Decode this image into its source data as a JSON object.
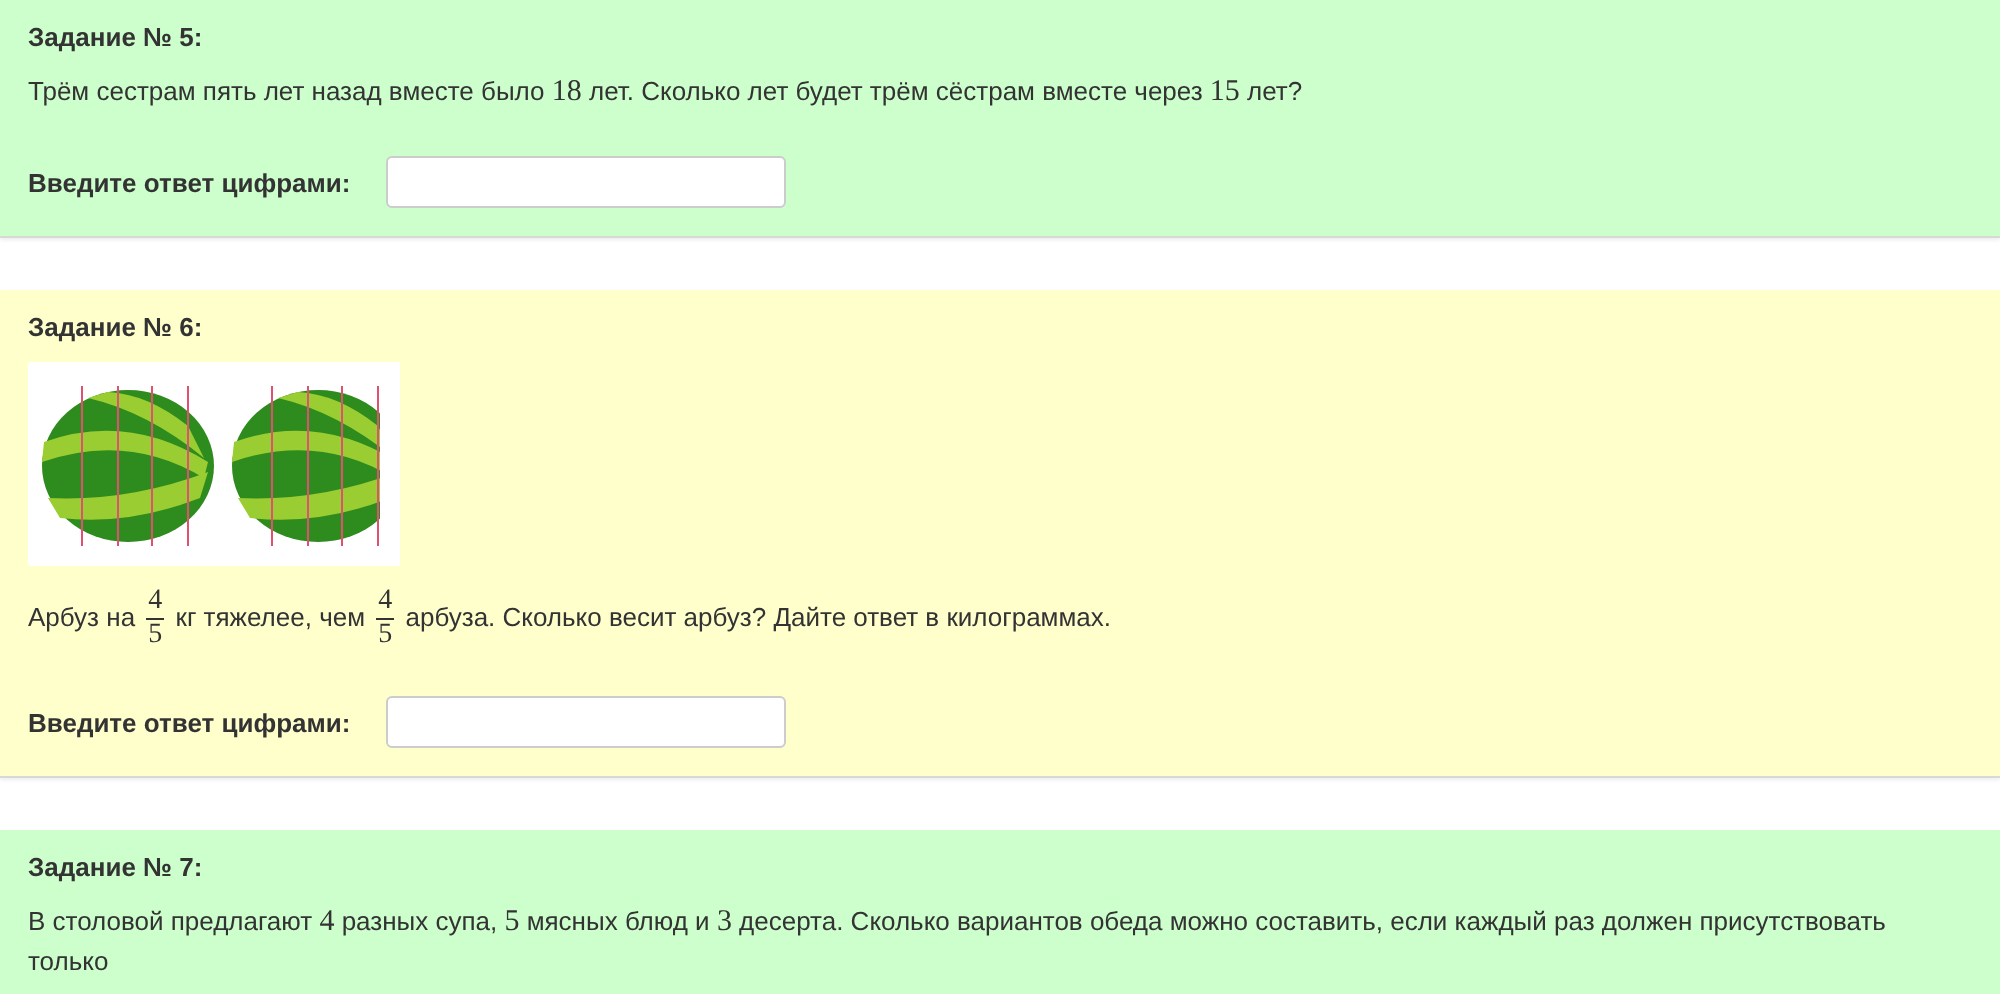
{
  "tasks": [
    {
      "title": "Задание № 5:",
      "color": "#ccffcc",
      "question": [
        {
          "kind": "text",
          "text": "Трём сестрам пять лет назад вместе было "
        },
        {
          "kind": "math",
          "text": "18"
        },
        {
          "kind": "text",
          "text": " лет. Сколько лет будет трём сёстрам вместе через "
        },
        {
          "kind": "math",
          "text": "15"
        },
        {
          "kind": "text",
          "text": " лет?"
        }
      ],
      "answer_label": "Введите ответ цифрами:"
    },
    {
      "title": "Задание № 6:",
      "color": "#ffffcc",
      "question": [
        {
          "kind": "text",
          "text": "Арбуз на "
        },
        {
          "kind": "frac",
          "num": "4",
          "den": "5"
        },
        {
          "kind": "text",
          "text": " кг тяжелее, чем "
        },
        {
          "kind": "frac",
          "num": "4",
          "den": "5"
        },
        {
          "kind": "text",
          "text": " арбуза. Сколько весит арбуз? Дайте ответ в килограммах."
        }
      ],
      "answer_label": "Введите ответ цифрами:"
    },
    {
      "title": "Задание № 7:",
      "color": "#ccffcc",
      "question": [
        {
          "kind": "text",
          "text": "В столовой предлагают "
        },
        {
          "kind": "math",
          "text": "4"
        },
        {
          "kind": "text",
          "text": " разных супа, "
        },
        {
          "kind": "math",
          "text": "5"
        },
        {
          "kind": "text",
          "text": " мясных блюд и "
        },
        {
          "kind": "math",
          "text": "3"
        },
        {
          "kind": "text",
          "text": " десерта. Сколько вариантов обеда можно составить, если каждый раз должен присутствовать только"
        }
      ]
    }
  ]
}
